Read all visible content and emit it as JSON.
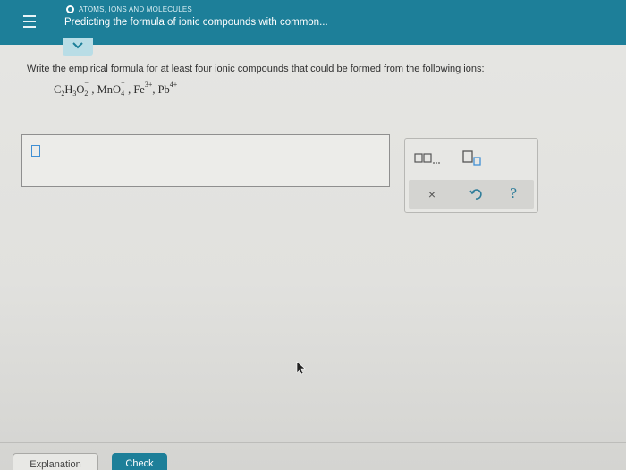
{
  "header": {
    "section_label": "ATOMS, IONS AND MOLECULES",
    "topic_title": "Predicting the formula of ionic compounds with common..."
  },
  "question": {
    "prompt": "Write the empirical formula for at least four ionic compounds that could be formed from the following ions:",
    "ions": [
      {
        "parts": [
          "C",
          "2",
          "H",
          "3",
          "O",
          "2",
          "−"
        ],
        "display": "C2H3O2−"
      },
      {
        "display": "MnO4−"
      },
      {
        "display": "Fe3+"
      },
      {
        "display": "Pb4+"
      }
    ]
  },
  "palette": {
    "multi_tool_label": "□,□,...",
    "subscript_tool_label": "□□",
    "clear_label": "×",
    "undo_icon": "undo-icon",
    "help_label": "?"
  },
  "footer": {
    "explanation_label": "Explanation",
    "check_label": "Check"
  },
  "colors": {
    "header_bg": "#1d7f99",
    "accent": "#1d7f99",
    "cursor_blue": "#3f8fd4"
  }
}
